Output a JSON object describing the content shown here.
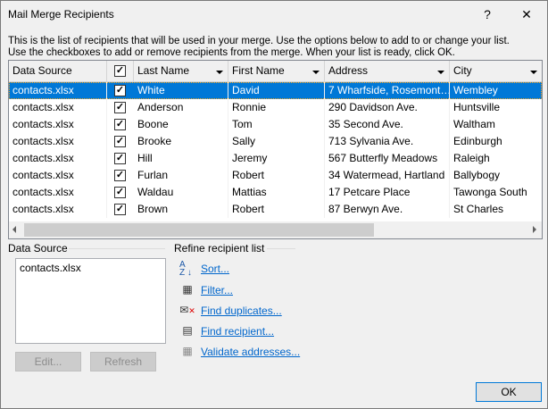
{
  "window": {
    "title": "Mail Merge Recipients",
    "help": "?",
    "close": "✕"
  },
  "intro": [
    "This is the list of recipients that will be used in your merge.  Use the options below to add to or change your list.",
    "Use the checkboxes to add or remove recipients from the merge.  When your list is ready, click OK."
  ],
  "columns": [
    "Data Source",
    "",
    "Last Name",
    "First Name",
    "Address",
    "City"
  ],
  "rows": [
    {
      "source": "contacts.xlsx",
      "checked": true,
      "last": "White",
      "first": "David",
      "address": "7 Wharfside, Rosemont…",
      "city": "Wembley"
    },
    {
      "source": "contacts.xlsx",
      "checked": true,
      "last": "Anderson",
      "first": "Ronnie",
      "address": "290 Davidson Ave.",
      "city": "Huntsville"
    },
    {
      "source": "contacts.xlsx",
      "checked": true,
      "last": "Boone",
      "first": "Tom",
      "address": "35 Second Ave.",
      "city": "Waltham"
    },
    {
      "source": "contacts.xlsx",
      "checked": true,
      "last": "Brooke",
      "first": "Sally",
      "address": "713 Sylvania Ave.",
      "city": "Edinburgh"
    },
    {
      "source": "contacts.xlsx",
      "checked": true,
      "last": "Hill",
      "first": "Jeremy",
      "address": "567 Butterfly Meadows",
      "city": "Raleigh"
    },
    {
      "source": "contacts.xlsx",
      "checked": true,
      "last": "Furlan",
      "first": "Robert",
      "address": "34 Watermead, Hartland",
      "city": "Ballybogy"
    },
    {
      "source": "contacts.xlsx",
      "checked": true,
      "last": "Waldau",
      "first": "Mattias",
      "address": "17 Petcare Place",
      "city": "Tawonga South"
    },
    {
      "source": "contacts.xlsx",
      "checked": true,
      "last": "Brown",
      "first": "Robert",
      "address": "87 Berwyn Ave.",
      "city": "St Charles"
    }
  ],
  "data_source": {
    "label": "Data Source",
    "items": [
      "contacts.xlsx"
    ],
    "edit": "Edit...",
    "refresh": "Refresh"
  },
  "refine": {
    "label": "Refine recipient list",
    "links": [
      {
        "label": "Sort...",
        "icon": "sort-az-icon"
      },
      {
        "label": "Filter...",
        "icon": "filter-icon"
      },
      {
        "label": "Find duplicates...",
        "icon": "find-duplicates-icon"
      },
      {
        "label": "Find recipient...",
        "icon": "find-recipient-icon"
      },
      {
        "label": "Validate addresses...",
        "icon": "validate-addresses-icon"
      }
    ]
  },
  "ok": "OK",
  "colors": {
    "selection": "#0078d7",
    "link": "#0066cc"
  }
}
